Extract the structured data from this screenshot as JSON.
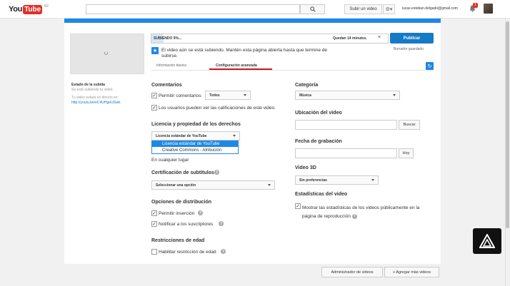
{
  "header": {
    "logo_you": "You",
    "logo_tube": "Tube",
    "logo_country": "AR",
    "upload_label": "Subir un video",
    "user_email": "lucas.esteban.delgado@gmail.com",
    "notifications_count": "1"
  },
  "upload": {
    "progress_label": "SUBIENDO 5%...",
    "progress_percent": 5,
    "remaining": "Quedan 14 minutos.",
    "cancel": "×",
    "publish_label": "Publicar",
    "draft_saved": "Borrador guardado",
    "info_message": "El video aún se está subiendo. Mantén esta página abierta hasta que termine de subirse.",
    "status_title": "Estado de la subida",
    "status_sub": "Se está subiendo tu video.",
    "live_note": "Tu video estará en directo en:",
    "live_link": "http://youtu.be/eC4UHgeUGwk"
  },
  "tabs": [
    {
      "label": "Información básica"
    },
    {
      "label": "Configuración avanzada"
    }
  ],
  "left": {
    "comments_title": "Comentarios",
    "allow_comments": "Permitir comentarios",
    "comments_select": "Todos",
    "ratings_visible": "Los usuarios pueden ver las calificaciones de este video.",
    "license_title": "Licencia y propiedad de los derechos",
    "license_select": "Licencia estándar de YouTube",
    "license_options": [
      "Licencia estándar de YouTube",
      "Creative Commons - Atribución"
    ],
    "anywhere": "En cualquier lugar",
    "subtitles_title": "Certificación de subtítulos",
    "subtitles_select": "Seleccionar una opción",
    "distribution_title": "Opciones de distribución",
    "allow_embed": "Permitir inserción",
    "notify_subs": "Notificar a los suscriptores",
    "age_title": "Restricciones de edad",
    "age_enable": "Habilitar restricción de edad"
  },
  "right": {
    "category_title": "Categoría",
    "category_select": "Música",
    "location_title": "Ubicación del video",
    "location_value": "",
    "search_btn": "Buscar",
    "date_title": "Fecha de grabación",
    "date_value": "",
    "today_btn": "Hoy",
    "video3d_title": "Video 3D",
    "video3d_select": "Sin preferencias",
    "stats_title": "Estadísticas del video",
    "stats_label": "Mostrar las estadísticas de los videos públicamente en la página de reproducción"
  },
  "footer": {
    "manager_label": "Administrador de videos",
    "add_more_label": "+ Agregar más videos"
  },
  "colors": {
    "accent": "#1e88e5",
    "publish": "#167ac6",
    "youtube_red": "#e52d27"
  }
}
